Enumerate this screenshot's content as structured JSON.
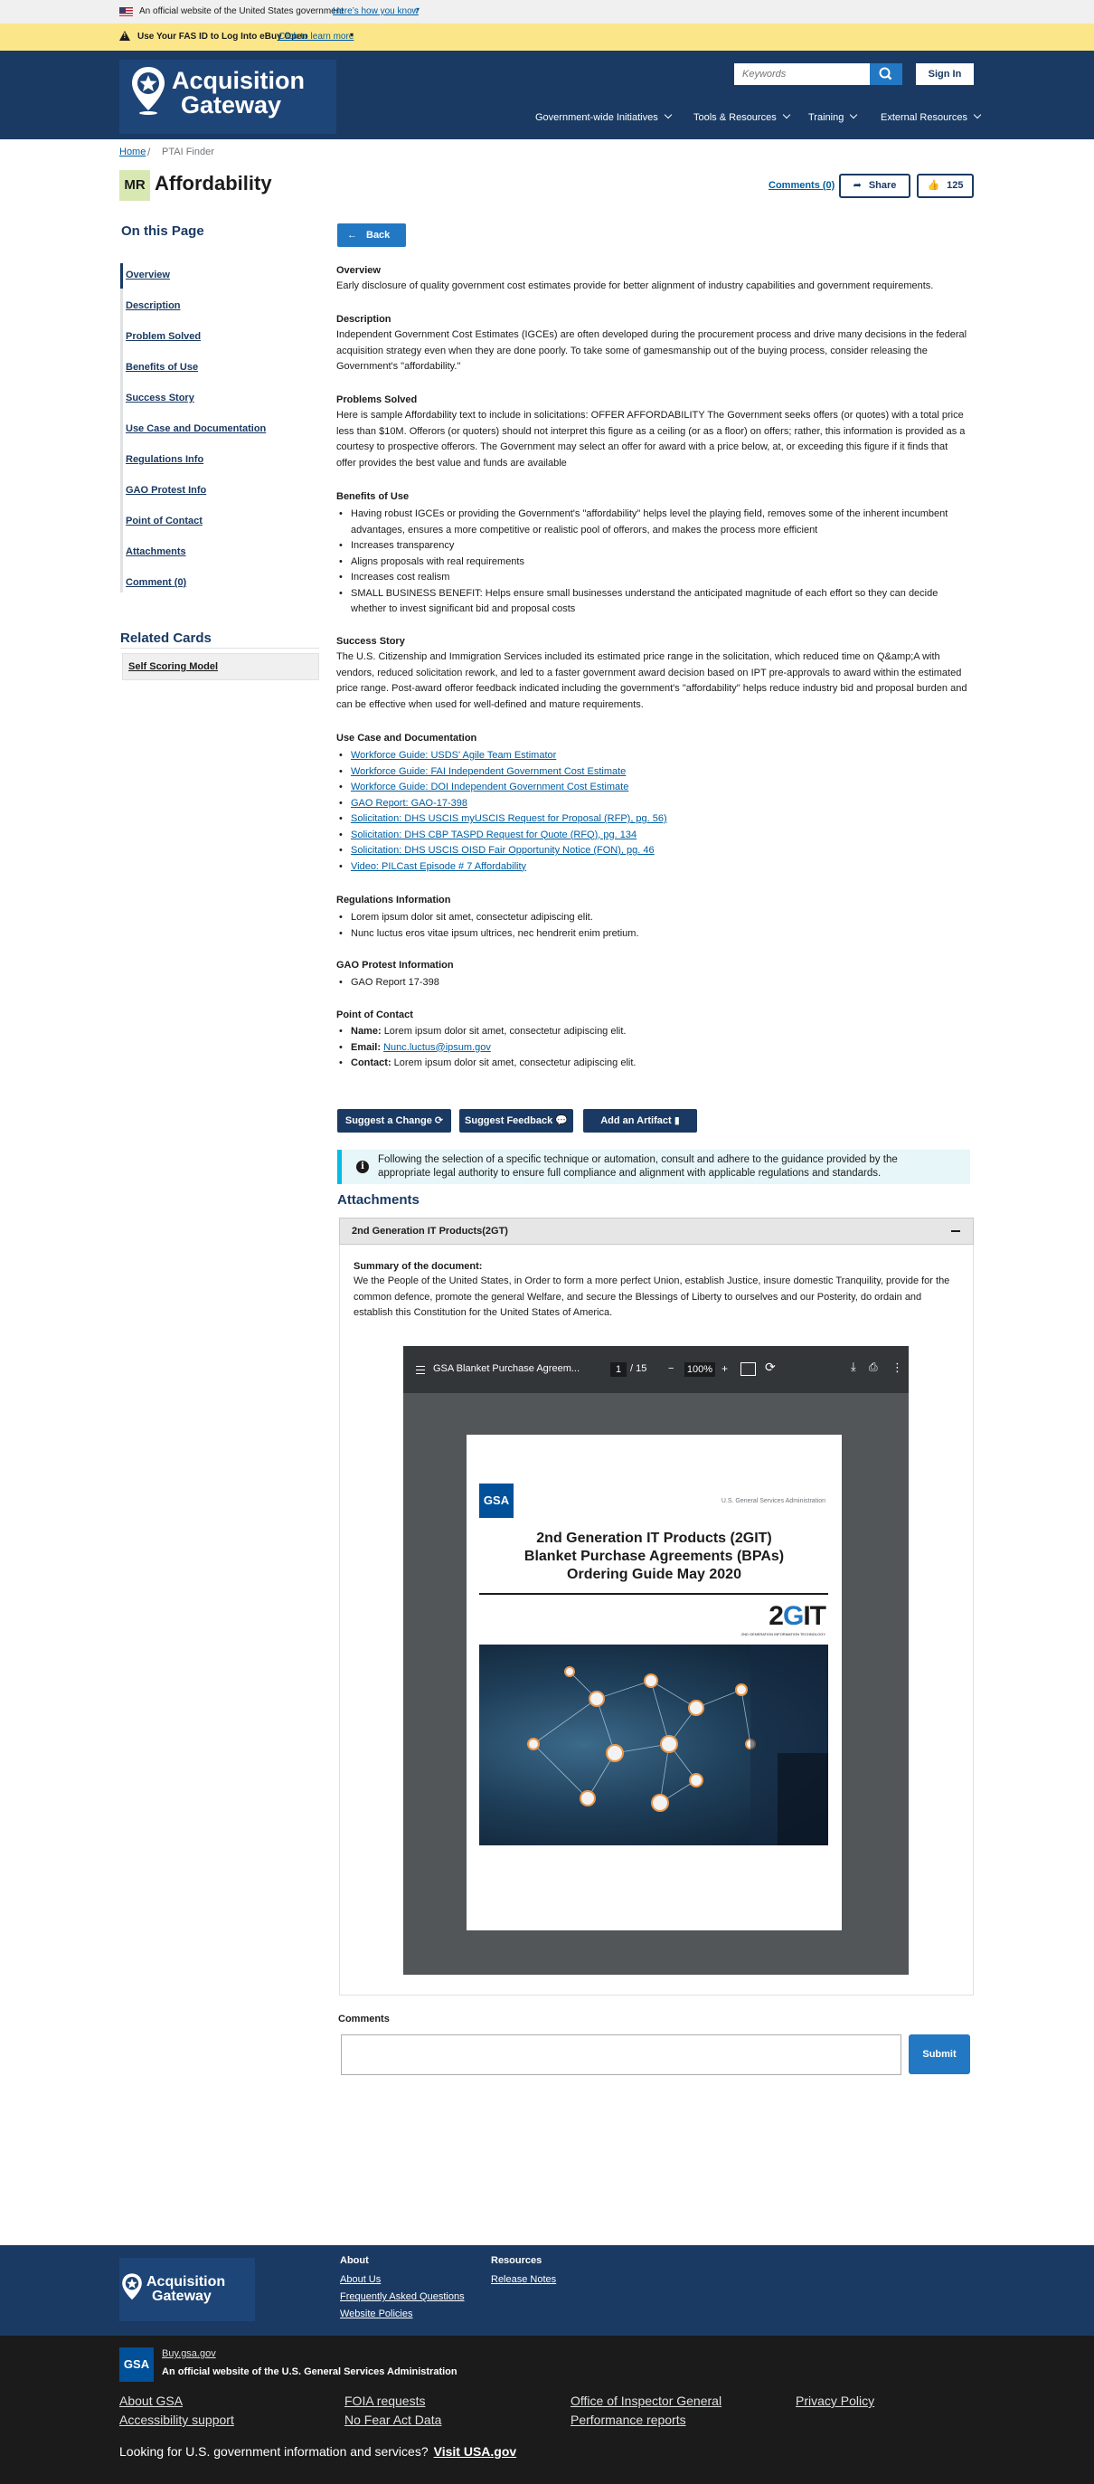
{
  "gov_banner": {
    "text": "An official website of the United States government",
    "link": "Here’s how you know"
  },
  "alert": {
    "message": "Use Your FAS ID to Log Into eBuy Open",
    "link": "Click to learn more"
  },
  "header": {
    "logo_line1": "Acquisition",
    "logo_line2": "Gateway",
    "search_placeholder": "Keywords",
    "sign_in": "Sign In",
    "nav": [
      "Government-wide Initiatives",
      "Tools & Resources",
      "Training",
      "External Resources"
    ]
  },
  "breadcrumb": {
    "home": "Home",
    "separator": "/",
    "current": "PTAI Finder"
  },
  "title_bar": {
    "badge": "MR",
    "title": "Affordability",
    "comments_link": "Comments (0)",
    "share": "Share",
    "likes": "125"
  },
  "sidebar": {
    "heading": "On this Page",
    "items": [
      "Overview",
      "Description",
      "Problem Solved",
      "Benefits of Use",
      "Success Story",
      "Use Case and Documentation",
      "Regulations Info",
      "GAO Protest Info",
      "Point of Contact",
      "Attachments",
      "Comment (0)"
    ],
    "related_heading": "Related Cards",
    "related_items": [
      "Self Scoring Model"
    ]
  },
  "main": {
    "back": "Back",
    "overview": {
      "heading": "Overview",
      "body": "Early disclosure of quality government cost estimates provide for better alignment of industry capabilities and government requirements."
    },
    "description": {
      "heading": "Description",
      "body": "Independent Government Cost Estimates (IGCEs) are often developed during the procurement process and drive many decisions in the federal acquisition strategy even when they are done poorly. To take some of gamesmanship out of the buying process, consider releasing the Government's \"affordability.\""
    },
    "problems": {
      "heading": "Problems Solved",
      "body": "Here is sample Affordability text to include in solicitations: OFFER AFFORDABILITY The Government seeks offers (or quotes) with a total price less than $10M. Offerors (or quoters) should not interpret this figure as a ceiling (or as a floor) on offers; rather, this information is provided as a courtesy to prospective offerors. The Government may select an offer for award with a price below, at, or exceeding this figure if it finds that offer provides the best value and funds are available"
    },
    "benefits": {
      "heading": "Benefits of Use",
      "items": [
        "Having robust IGCEs or providing the Government's \"affordability\" helps level the playing field, removes some of the inherent incumbent advantages, ensures a more competitive or realistic pool of offerors, and makes the process more efficient",
        "Increases transparency",
        "Aligns proposals with real requirements",
        "Increases cost realism",
        "SMALL BUSINESS BENEFIT: Helps ensure small businesses understand the anticipated magnitude of each effort so they can decide whether to invest significant bid and proposal costs"
      ]
    },
    "success": {
      "heading": "Success Story",
      "body": "The U.S. Citizenship and Immigration Services included its estimated price range in the solicitation, which reduced time on Q&amp;A with vendors, reduced solicitation rework, and led to a faster government award decision based on IPT pre-approvals to award within the estimated price range. Post-award offeror feedback indicated including the government's \"affordability\" helps reduce industry bid and proposal burden and can be effective when used for well-defined and mature requirements."
    },
    "use_case": {
      "heading": "Use Case and Documentation",
      "links": [
        "Workforce Guide: USDS' Agile Team Estimator",
        "Workforce Guide: FAI Independent Government Cost Estimate",
        "Workforce Guide: DOI Independent Government Cost Estimate",
        "GAO Report: GAO-17-398",
        "Solicitation: DHS USCIS myUSCIS Request for Proposal (RFP), pg. 56)",
        "Solicitation: DHS CBP TASPD Request for Quote (RFQ), pg. 134",
        "Solicitation: DHS USCIS OISD Fair Opportunity Notice (FON), pg. 46",
        "Video: PILCast Episode # 7 Affordability"
      ]
    },
    "regulations": {
      "heading": "Regulations Information",
      "items": [
        "Lorem ipsum dolor sit amet, consectetur adipiscing elit.",
        "Nunc luctus eros vitae ipsum ultrices, nec hendrerit enim pretium."
      ]
    },
    "gao": {
      "heading": "GAO Protest Information",
      "items": [
        "GAO Report 17-398"
      ]
    },
    "contact": {
      "heading": "Point of Contact",
      "name_label": "Name:",
      "name": "Lorem ipsum dolor sit amet, consectetur adipiscing elit.",
      "email_label": "Email:",
      "email": "Nunc.luctus@ipsum.gov",
      "contact_label": "Contact:",
      "contact": "Lorem ipsum dolor sit amet, consectetur adipiscing elit."
    },
    "buttons": {
      "suggest_change": "Suggest a Change",
      "suggest_feedback": "Suggest Feedback",
      "add_artifact": "Add an Artifact"
    },
    "info": "Following the selection of a specific technique or automation, consult and adhere to the guidance provided by the appropriate legal authority to ensure full compliance and alignment with applicable regulations and standards.",
    "attachments": {
      "heading": "Attachments",
      "accordion_title": "2nd Generation IT Products(2GT)",
      "summary_heading": "Summary of the document:",
      "summary": "We the People of the United States, in Order to form a more perfect Union, establish Justice, insure domestic Tranquility, provide for the common defence, promote the general Welfare, and secure the Blessings of Liberty to ourselves and our Posterity, do ordain and establish this Constitution for the United States of America."
    },
    "pdf": {
      "filename": "GSA Blanket Purchase Agreem...",
      "page": "1",
      "page_total": "/ 15",
      "zoom_minus": "−",
      "zoom": "100%",
      "zoom_plus": "+",
      "org": "U.S. General Services Administration",
      "gsa": "GSA",
      "title_l1": "2nd Generation IT Products (2GIT)",
      "title_l2": "Blanket Purchase Agreements (BPAs)",
      "title_l3": "Ordering Guide May 2020",
      "logo_a": "2",
      "logo_b": "G",
      "logo_c": "IT",
      "logo_sub": "2ND GENERATION INFORMATION TECHNOLOGY"
    },
    "comments": {
      "heading": "Comments",
      "submit": "Submit"
    }
  },
  "footer": {
    "logo_line1": "Acquisition",
    "logo_line2": "Gateway",
    "about_heading": "About",
    "about_links": [
      "About Us",
      "Frequently Asked Questions",
      "Website Policies"
    ],
    "resources_heading": "Resources",
    "resources_links": [
      "Release Notes"
    ],
    "gsa": "GSA",
    "buy": "Buy.gsa.gov",
    "official": "An official website of the U.S. General Services Administration",
    "links": [
      "About GSA",
      "FOIA requests",
      "Office of Inspector General",
      "Privacy Policy",
      "Accessibility support",
      "No Fear Act Data",
      "Performance reports"
    ],
    "usa_text": "Looking for U.S. government information and services?",
    "usa_link": "Visit USA.gov"
  },
  "colors": {
    "navy": "#1a3a63",
    "primary": "#2378c3",
    "alert": "#fce68a",
    "info": "#e7f6f8"
  }
}
